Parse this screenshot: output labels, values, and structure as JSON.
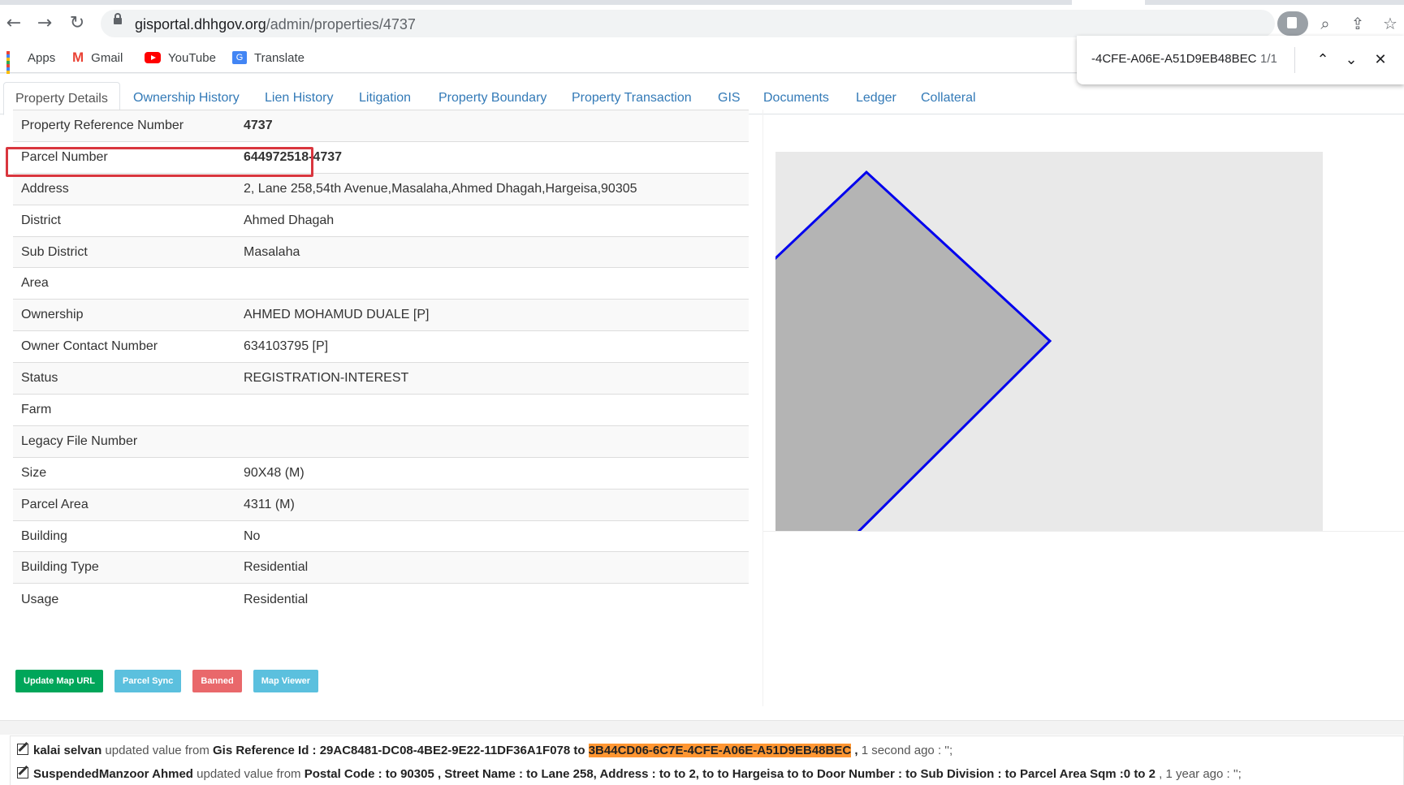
{
  "browser": {
    "url_host": "gisportal.dhhgov.org",
    "url_path": "/admin/properties/4737",
    "bookmarks": [
      {
        "label": "Apps",
        "icon": "apps-grid-icon"
      },
      {
        "label": "Gmail",
        "icon": "gmail-icon"
      },
      {
        "label": "YouTube",
        "icon": "youtube-icon"
      },
      {
        "label": "Translate",
        "icon": "translate-icon"
      }
    ],
    "find": {
      "query": "-4CFE-A06E-A51D9EB48BEC",
      "count": "1/1"
    }
  },
  "tabs": [
    {
      "label": "Property Details",
      "active": true
    },
    {
      "label": "Ownership History"
    },
    {
      "label": "Lien History"
    },
    {
      "label": "Litigation"
    },
    {
      "label": "Property Boundary"
    },
    {
      "label": "Property Transaction"
    },
    {
      "label": "GIS"
    },
    {
      "label": "Documents"
    },
    {
      "label": "Ledger"
    },
    {
      "label": "Collateral"
    }
  ],
  "details": [
    {
      "key": "Property Reference Number",
      "value": "4737"
    },
    {
      "key": "Parcel Number",
      "value": "644972518-4737"
    },
    {
      "key": "Address",
      "value": "2, Lane 258,54th Avenue,Masalaha,Ahmed Dhagah,Hargeisa,90305"
    },
    {
      "key": "District",
      "value": "Ahmed Dhagah"
    },
    {
      "key": "Sub District",
      "value": "Masalaha"
    },
    {
      "key": "Area",
      "value": ""
    },
    {
      "key": "Ownership",
      "value": "AHMED MOHAMUD DUALE [P]"
    },
    {
      "key": "Owner Contact Number",
      "value": "634103795 [P]"
    },
    {
      "key": "Status",
      "value": "REGISTRATION-INTEREST"
    },
    {
      "key": "Farm",
      "value": ""
    },
    {
      "key": "Legacy File Number",
      "value": ""
    },
    {
      "key": "Size",
      "value": "90X48 (M)"
    },
    {
      "key": "Parcel Area",
      "value": "4311 (M)"
    },
    {
      "key": "Building",
      "value": "No"
    },
    {
      "key": "Building Type",
      "value": "Residential"
    },
    {
      "key": "Usage",
      "value": "Residential"
    }
  ],
  "buttons": [
    {
      "label": "Update Map URL",
      "color": "#00a65a"
    },
    {
      "label": "Parcel Sync",
      "color": "#5bc0de"
    },
    {
      "label": "Banned",
      "color": "#e9686b"
    },
    {
      "label": "Map Viewer",
      "color": "#5bc0de"
    }
  ],
  "colors": {
    "tab_link": "#337ab7",
    "highlight_border": "#d9363e",
    "parcel_fill": "#b4b4b4",
    "parcel_stroke": "#0000ee",
    "find_highlight": "#ff9632"
  },
  "activity": [
    {
      "user": "kalai selvan",
      "text1": " updated value from ",
      "field": "Gis Reference Id : 29AC8481-DC08-4BE2-9E22-11DF36A1F078 to ",
      "highlight": "3B44CD06-6C7E-4CFE-A06E-A51D9EB48BEC",
      "tail_bold": " ,",
      "tail": " 1 second ago : '';"
    },
    {
      "user": "SuspendedManzoor Ahmed",
      "text1": " updated value from ",
      "field": "Postal Code : to 90305 , Street Name : to Lane 258, Address : to to 2, to to Hargeisa to to Door Number : to Sub Division : to Parcel Area Sqm :0 to 2",
      "tail": " , 1 year ago : '';"
    }
  ]
}
